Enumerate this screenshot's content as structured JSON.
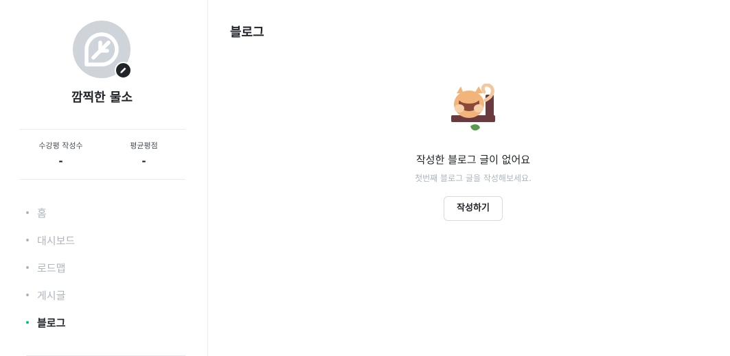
{
  "profile": {
    "name": "깜찍한 물소"
  },
  "stats": [
    {
      "label": "수강평 작성수",
      "value": "-"
    },
    {
      "label": "평균평점",
      "value": "-"
    }
  ],
  "nav": {
    "items": [
      {
        "label": "홈",
        "active": false
      },
      {
        "label": "대시보드",
        "active": false
      },
      {
        "label": "로드맵",
        "active": false
      },
      {
        "label": "게시글",
        "active": false
      },
      {
        "label": "블로그",
        "active": true
      }
    ]
  },
  "main": {
    "title": "블로그",
    "empty": {
      "title": "작성한 블로그 글이 없어요",
      "description": "첫번째 블로그 글을 작성해보세요.",
      "button_label": "작성하기"
    }
  },
  "colors": {
    "accent": "#00c471",
    "avatar_bg": "#ced4da",
    "muted_text": "#adb5bd"
  },
  "icons": {
    "avatar": "leaf-icon",
    "edit": "pencil-icon",
    "empty_state": "squirrel-on-branch-illustration"
  }
}
